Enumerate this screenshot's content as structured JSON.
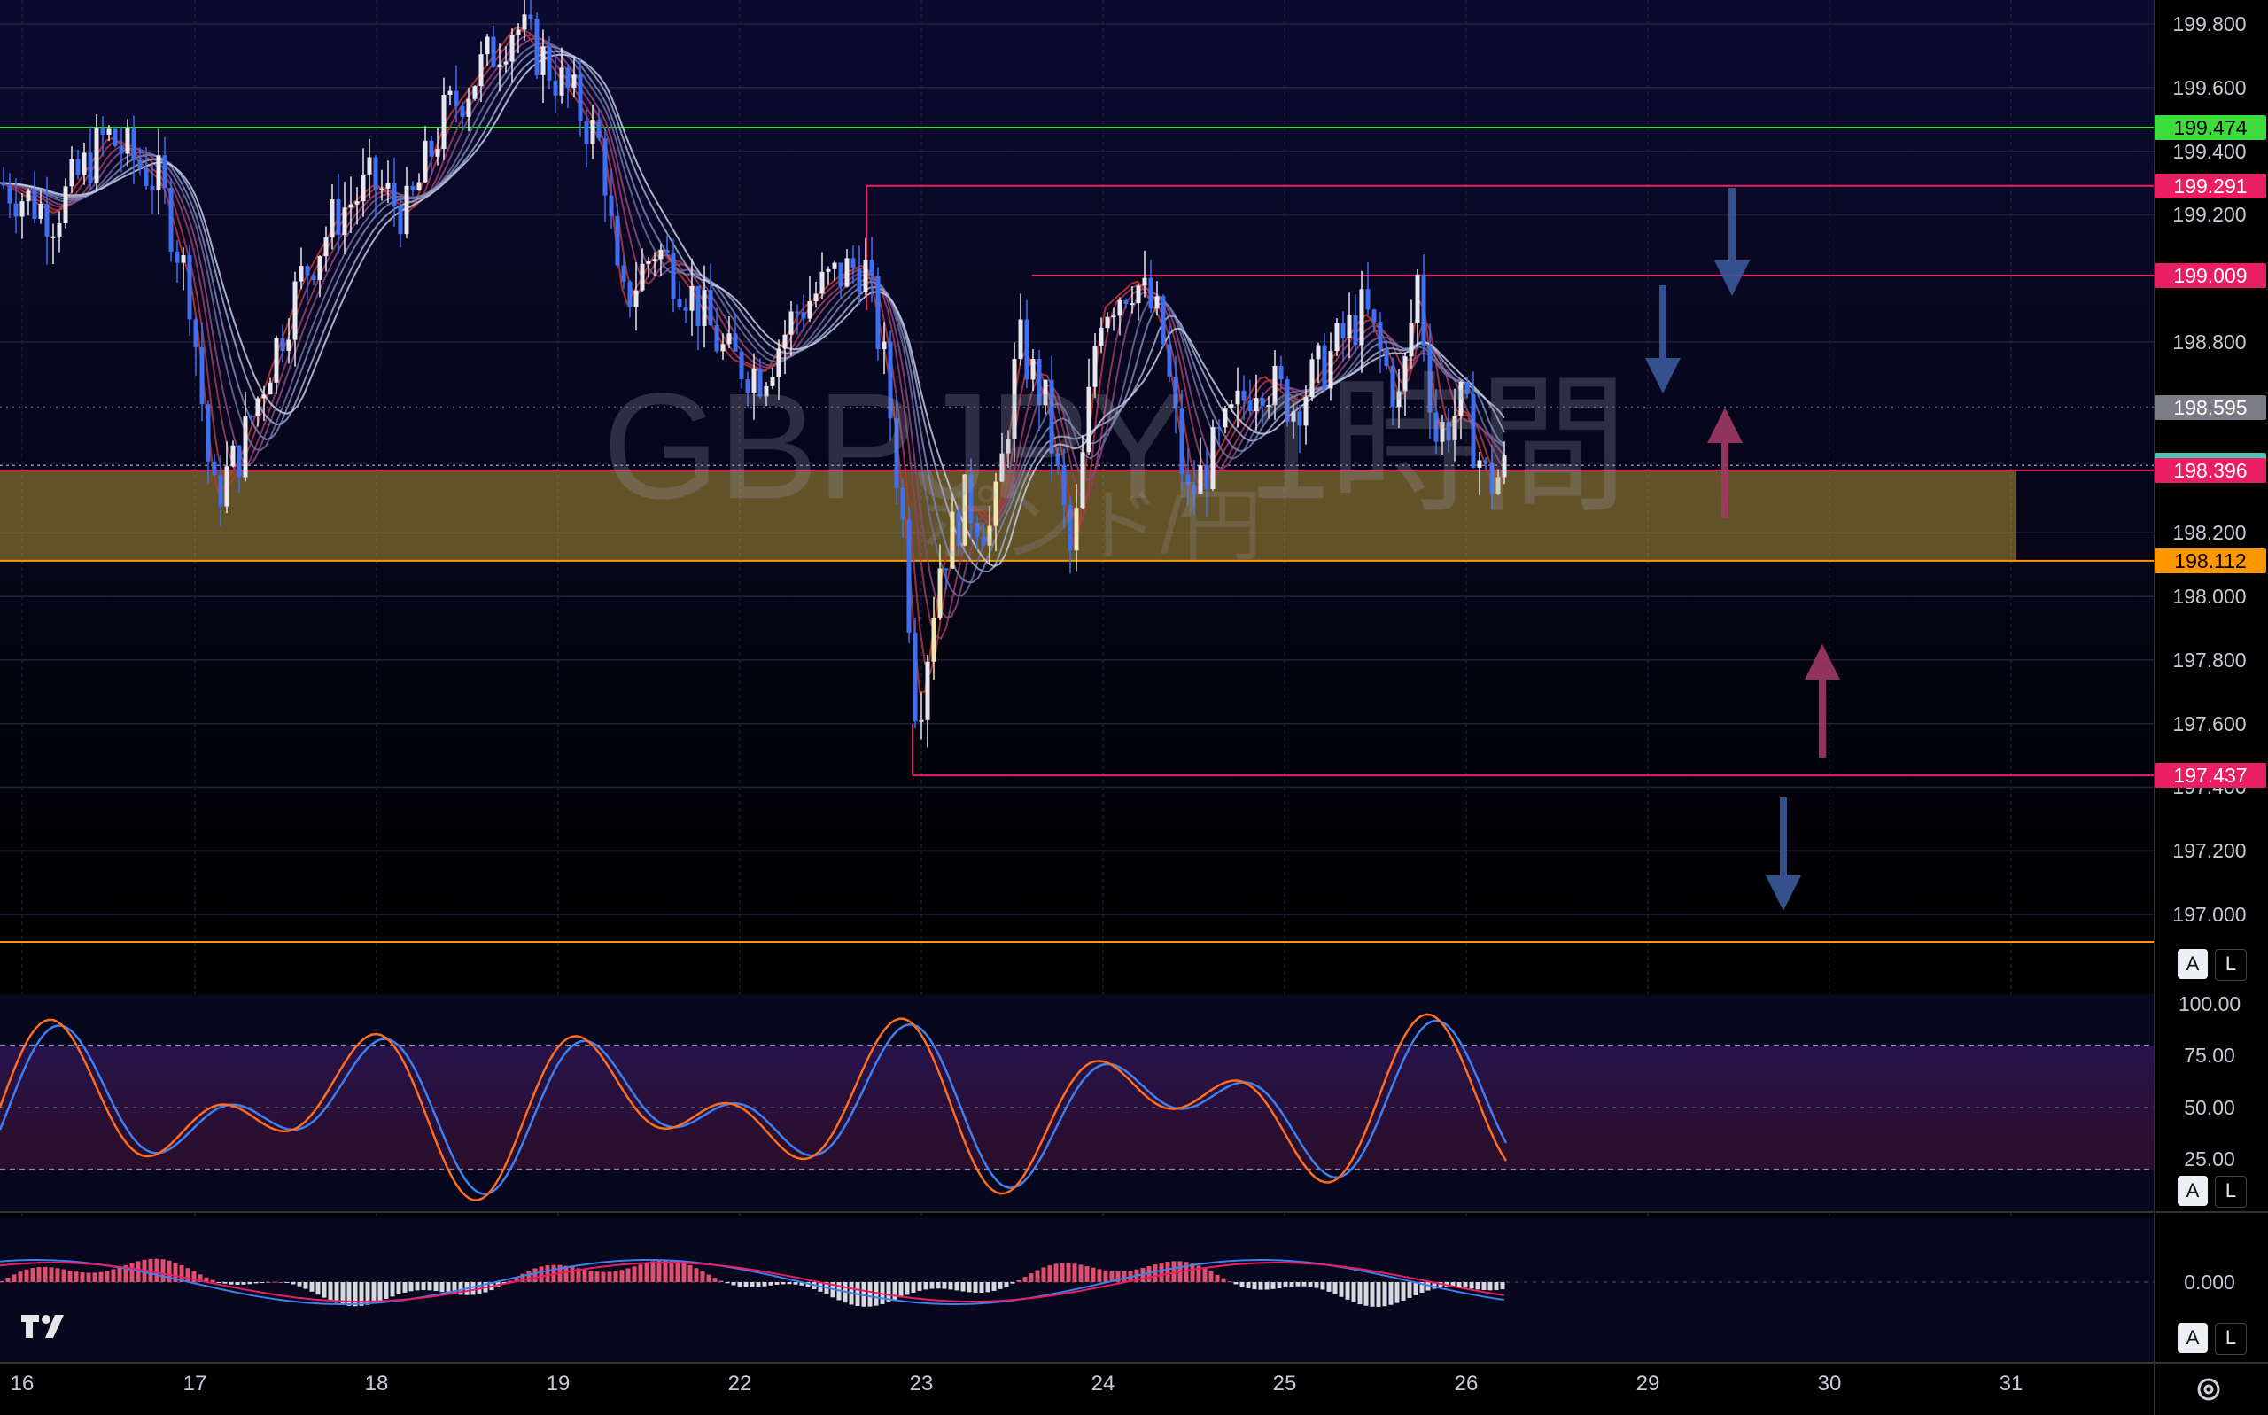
{
  "chart_data": {
    "type": "candlestick",
    "title": "GBPJPY, 1時間",
    "subtitle": "ポンド/円",
    "price_axis": {
      "ticks": [
        "199.800",
        "199.600",
        "199.400",
        "199.200",
        "198.800",
        "198.200",
        "198.000",
        "197.800",
        "197.600",
        "197.400",
        "197.200",
        "197.000"
      ],
      "tick_values": [
        199.8,
        199.6,
        199.4,
        199.2,
        198.8,
        198.2,
        198.0,
        197.8,
        197.6,
        197.4,
        197.2,
        197.0
      ]
    },
    "price_range": [
      196.9,
      199.87
    ],
    "date_ticks": [
      "16",
      "17",
      "18",
      "19",
      "22",
      "23",
      "24",
      "25",
      "26",
      "29",
      "30",
      "31"
    ],
    "price_tags": [
      {
        "label": "199.474",
        "value": 199.474,
        "color": "#3ddc3d",
        "text_color": "#000000"
      },
      {
        "label": "199.291",
        "value": 199.291,
        "color": "#e91e63",
        "text_color": "#ffffff"
      },
      {
        "label": "199.009",
        "value": 199.009,
        "color": "#e91e63",
        "text_color": "#ffffff"
      },
      {
        "label": "198.595",
        "value": 198.595,
        "color": "#7b7b85",
        "text_color": "#ffffff"
      },
      {
        "label": "198.412",
        "value": 198.412,
        "color": "#4fc3b8",
        "text_color": "#000000"
      },
      {
        "label": "198.396",
        "value": 198.396,
        "color": "#e91e63",
        "text_color": "#ffffff"
      },
      {
        "label": "198.112",
        "value": 198.112,
        "color": "#ff9800",
        "text_color": "#000000"
      },
      {
        "label": "197.437",
        "value": 197.437,
        "color": "#e91e63",
        "text_color": "#ffffff"
      }
    ],
    "zone": {
      "top": 198.396,
      "bottom": 198.112,
      "color": "#d4b13c"
    },
    "last_price": 198.412,
    "stochastic": {
      "ticks": [
        "100.00",
        "75.00",
        "50.00",
        "25.00"
      ],
      "overbought": 80,
      "oversold": 20,
      "k_color": "#ff6d1f",
      "d_color": "#3f7ff0"
    },
    "macd": {
      "ticks": [
        "0.000"
      ],
      "macd_color": "#3f7ff0",
      "signal_color": "#e91e63"
    },
    "colors": {
      "bull": "#e8e8ee",
      "bear": "#3f6ff0",
      "grid": "#22223a",
      "background_top": "#0a0a2a",
      "green_line": "#3ddc3d",
      "red_line": "#e91e63",
      "orange_line": "#ff9800"
    }
  },
  "controls": {
    "price_pane_auto": "A",
    "price_pane_log": "L",
    "stoch_pane_auto": "A",
    "stoch_pane_log": "L",
    "macd_pane_auto": "A",
    "macd_pane_log": "L"
  },
  "icons": {
    "brand": "tradingview-logo-icon",
    "settings": "settings-gear-icon"
  }
}
